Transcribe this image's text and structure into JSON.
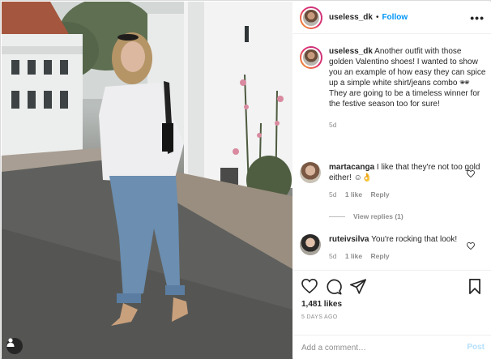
{
  "post": {
    "username": "useless_dk",
    "separator": "•",
    "follow_label": "Follow",
    "more_label": "•••"
  },
  "caption": {
    "username": "useless_dk",
    "text": "Another outfit with those golden Valentino shoes! I wanted to show you an example of how easy they can spice up a simple white shirt/jeans combo 🕶 They are going to be a timeless winner for the festive season too for sure!",
    "age": "5d"
  },
  "comments": [
    {
      "username": "martacanga",
      "text": "I like that they're not too gold either! ☺👌",
      "age": "5d",
      "likes_label": "1 like",
      "reply_label": "Reply",
      "view_replies": "View replies (1)"
    },
    {
      "username": "ruteivsilva",
      "text": "You're rocking that look!",
      "age": "5d",
      "likes_label": "1 like",
      "reply_label": "Reply"
    }
  ],
  "actions": {
    "likes": "1,481 likes",
    "posted": "5 DAYS AGO"
  },
  "add_comment": {
    "placeholder": "Add a comment…",
    "post_label": "Post"
  },
  "colors": {
    "link": "#0095f6",
    "post_disabled": "#b3dffc",
    "muted": "#8e8e8e"
  },
  "icons": [
    "user-tag-icon",
    "more-icon",
    "heart-icon",
    "comment-icon",
    "share-icon",
    "bookmark-icon"
  ]
}
